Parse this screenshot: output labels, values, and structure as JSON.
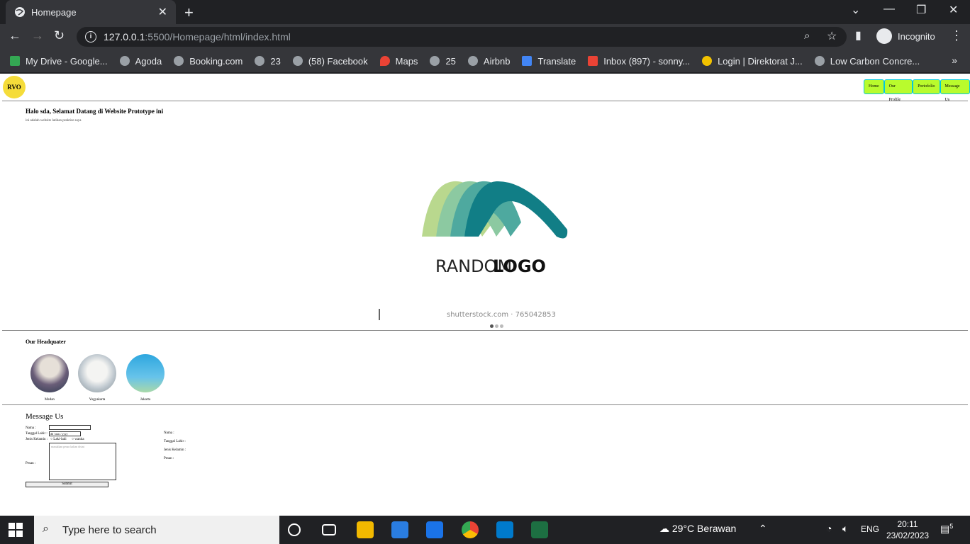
{
  "browser": {
    "tab_title": "Homepage",
    "url_host": "127.0.0.1",
    "url_path": ":5500/Homepage/html/index.html",
    "incognito_label": "Incognito",
    "bookmarks": [
      "My Drive - Google...",
      "Agoda",
      "Booking.com",
      "23",
      "(58) Facebook",
      "Maps",
      "25",
      "Airbnb",
      "Translate",
      "Inbox (897) - sonny...",
      "Login | Direktorat J...",
      "Low Carbon Concre..."
    ]
  },
  "site": {
    "logo_text": "RVO",
    "nav": [
      "Home",
      "Our Profile",
      "Portofolio",
      "Message Us"
    ],
    "hero_title": "Halo sda, Selamat Datang di Website Prototype ini",
    "hero_subtitle": "ini adalah website latihan praktice saya",
    "slide": {
      "brand_light": "RANDOM",
      "brand_bold": "LOGO",
      "watermark": "shutterstock.com · 765042853"
    },
    "hq_title": "Our Headquater",
    "hq": [
      "Medan",
      "Yogyakarta",
      "Jakarta"
    ],
    "message_title": "Message Us",
    "form": {
      "nama_label": "Nama :",
      "tanggal_label": "Tanggal Lahir :",
      "date_placeholder": "dd / mm / yyyy",
      "jenis_label": "Jenis Kelamin :",
      "laki": "Laki-laki",
      "wanita": "wanita",
      "pesan_label": "Pesan :",
      "pesan_placeholder": "masukkan pesan kalian disini",
      "submit": "Submit"
    },
    "output": [
      "Nama :",
      "Tanggal Lahir :",
      "Jenis Kelamin :",
      "Pesan :"
    ]
  },
  "taskbar": {
    "search_placeholder": "Type here to search",
    "weather": "29°C  Berawan",
    "lang": "ENG",
    "time": "20:11",
    "date": "23/02/2023",
    "notif_count": "5"
  }
}
